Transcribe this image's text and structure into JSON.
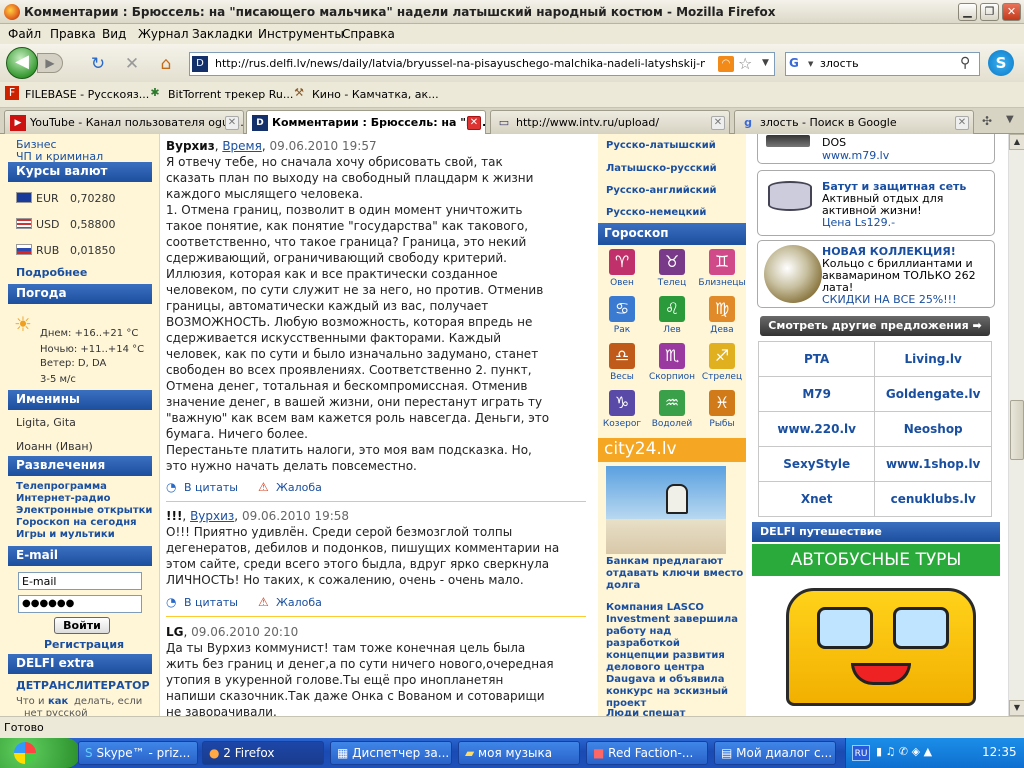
{
  "window": {
    "title": "Комментарии : Брюссель: на \"писающего мальчика\" надели латышский народный костюм - Mozilla Firefox"
  },
  "menu": [
    "Файл",
    "Правка",
    "Вид",
    "Журнал",
    "Закладки",
    "Инструменты",
    "Справка"
  ],
  "nav": {
    "url": "http://rus.delfi.lv/news/daily/latvia/bryussel-na-pisayuschego-malchika-nadeli-latyshskij-narodnyj-kostyum.d?id",
    "search_value": "злость"
  },
  "bookmarks": [
    {
      "label": "FILEBASE - Русскояз...",
      "icon": "filebase-icon",
      "color": "#cc2200"
    },
    {
      "label": "BitTorrent трекер Ru...",
      "icon": "bittorrent-icon",
      "color": "#2d7a2d"
    },
    {
      "label": "Кино - Камчатка, ак...",
      "icon": "broom-icon",
      "color": "#8a5a2a"
    }
  ],
  "tabs": [
    {
      "label": "YouTube - Канал пользователя ogut...",
      "icon": "youtube-icon",
      "active": false
    },
    {
      "label": "Комментарии : Брюссель: на \"п...",
      "icon": "delfi-icon",
      "active": true
    },
    {
      "label": "http://www.intv.ru/upload/",
      "icon": "page-icon",
      "active": false
    },
    {
      "label": "злость - Поиск в Google",
      "icon": "google-icon",
      "active": false
    }
  ],
  "left": {
    "links_top": [
      "Бизнес",
      "ЧП и криминал"
    ],
    "currency_title": "Курсы валют",
    "currencies": [
      {
        "code": "EUR",
        "rate": "0,70280",
        "flag": "eu-flag-icon"
      },
      {
        "code": "USD",
        "rate": "0,58800",
        "flag": "us-flag-icon"
      },
      {
        "code": "RUB",
        "rate": "0,01850",
        "flag": "ru-flag-icon"
      }
    ],
    "more": "Подробнее",
    "weather_title": "Погода",
    "weather": [
      "Днем: +16..+21 °C",
      "Ночью: +11..+14 °C",
      "Ветер: D, DA",
      "3-5 м/с"
    ],
    "names_title": "Именины",
    "names": [
      "Ligita, Gita",
      "Иоанн (Иван)"
    ],
    "fun_title": "Развлечения",
    "fun_links": [
      "Телепрограмма",
      "Интернет-радио",
      "Электронные открытки",
      "Гороскоп на сегодня",
      "Игры и мультики"
    ],
    "email_title": "E-mail",
    "email_placeholder": "E-mail",
    "password_value": "●●●●●●",
    "login_button": "Войти",
    "register": "Регистрация",
    "extra_title": "DELFI extra",
    "translit": "ДЕТРАНСЛИТЕРАТОР",
    "translit_desc": [
      "Что и",
      "как",
      "делать, если",
      "нет русской"
    ]
  },
  "comments": [
    {
      "author": "Вурхиз",
      "author_link": "Время",
      "date": "09.06.2010 19:57",
      "lines": [
        "Я отвечу тебе, но сначала хочу обрисовать свой, так",
        "сказать план по выходу на свободный плацдарм к жизни",
        "каждого мыслящего человека.",
        "1. Отмена границ, позволит в один момент уничтожить",
        "такое понятие, как понятие \"государства\" как такового,",
        "соответственно, что такое граница? Граница, это некий",
        "сдерживающий, ограничивающий свободу критерий.",
        "Иллюзия, которая как и все практически созданное",
        "человеком, по сути служит не за него, но против. Отменив",
        "границы, автоматически каждый из вас, получает",
        "ВОЗМОЖНОСТЬ. Любую возможность, которая впредь не",
        "сдерживается искусственными факторами. Каждый",
        "человек, как по сути и было изначально задумано, станет",
        "свободен во всех проявлениях. Соответственно 2. пункт,",
        "Отмена денег, тотальная и бескомпромиссная. Отменив",
        "значение денег, в вашей жизни, они перестанут играть ту",
        "\"важную\" как всем вам кажется роль навсегда. Деньги, это",
        "бумага. Ничего более.",
        "Перестаньте платить налоги, это моя вам подсказка. Но,",
        "это нужно начать делать повсеместно."
      ]
    },
    {
      "author": "!!!",
      "author_link": "Вурхиз",
      "date": "09.06.2010 19:58",
      "lines": [
        "О!!! Приятно удивлён. Среди серой безмозглой толпы",
        "дегенератов, дебилов и подонков, пишущих комментарии на",
        "этом сайте, среди всего этого быдла, вдруг ярко сверкнула",
        "ЛИЧНОСТЬ! Но таких, к сожалению, очень - очень мало."
      ]
    },
    {
      "author": "LG",
      "author_link": "",
      "date": "09.06.2010 20:10",
      "lines": [
        "Да ты Вурхиз коммунист! там тоже конечная цель была",
        "жить без границ и денег,а по сути ничего нового,очередная",
        "утопия в укуренной голове.Ты ещё про инопланетян",
        "напиши сказочник.Так даже Онка с Вованом и сотоварищи",
        "не заворачивали."
      ]
    }
  ],
  "comment_actions": {
    "quote": "В цитаты",
    "complaint": "Жалоба"
  },
  "mid": {
    "dict_links": [
      "Русско-латышский",
      "Латышско-русский",
      "Русско-английский",
      "Русско-немецкий"
    ],
    "horoscope_title": "Гороскоп",
    "zodiac": [
      {
        "label": "Овен",
        "icon": "aries-icon",
        "color": "#c0306a"
      },
      {
        "label": "Телец",
        "icon": "taurus-icon",
        "color": "#7a3a8a"
      },
      {
        "label": "Близнецы",
        "icon": "gemini-icon",
        "color": "#d04a8a"
      },
      {
        "label": "Рак",
        "icon": "cancer-icon",
        "color": "#3a7ad0"
      },
      {
        "label": "Лев",
        "icon": "leo-icon",
        "color": "#2a9a3a"
      },
      {
        "label": "Дева",
        "icon": "virgo-icon",
        "color": "#e08a2a"
      },
      {
        "label": "Весы",
        "icon": "libra-icon",
        "color": "#c05a1a"
      },
      {
        "label": "Скорпион",
        "icon": "scorpio-icon",
        "color": "#9a3aa0"
      },
      {
        "label": "Стрелец",
        "icon": "sagittarius-icon",
        "color": "#e0b020"
      },
      {
        "label": "Козерог",
        "icon": "capricorn-icon",
        "color": "#5a4aa8"
      },
      {
        "label": "Водолей",
        "icon": "aquarius-icon",
        "color": "#3aa04a"
      },
      {
        "label": "Рыбы",
        "icon": "pisces-icon",
        "color": "#d07a1a"
      }
    ],
    "city24": "city24.lv",
    "news": [
      "Банкам предлагают отдавать ключи вместо долга",
      "Компания LASCO Investment завершила работу над разработкой концепции развития делового центра Daugava и объявила конкурс на эскизный проект",
      "Люди спешат продавать"
    ]
  },
  "right": {
    "ad1": [
      "DOS",
      "www.m79.lv"
    ],
    "ad2": {
      "title": "Батут и защитная сеть",
      "text": [
        "Активный отдых для",
        "активной жизни!"
      ],
      "price": "Цена Ls129.-"
    },
    "ad3": {
      "title": "НОВАЯ КОЛЛЕКЦИЯ!",
      "text": [
        "Кольцо с бриллиантами и",
        "аквамарином ТОЛЬКО 262",
        "лата!"
      ],
      "promo": "СКИДКИ НА ВСЕ 25%!!!"
    },
    "more_offers": "Смотреть другие предложения ➡",
    "shops": [
      [
        "PTA",
        "Living.lv"
      ],
      [
        "M79",
        "Goldengate.lv"
      ],
      [
        "www.220.lv",
        "Neoshop"
      ],
      [
        "SexyStyle",
        "www.1shop.lv"
      ],
      [
        "Xnet",
        "cenuklubs.lv"
      ]
    ],
    "travel_title": "DELFI путешествие",
    "bus_banner": "АВТОБУСНЫЕ ТУРЫ"
  },
  "status": "Готово",
  "taskbar": {
    "items": [
      {
        "label": "Skype™ - priz...",
        "icon": "skype-icon"
      },
      {
        "label": "2 Firefox",
        "icon": "firefox-icon"
      },
      {
        "label": "Диспетчер за...",
        "icon": "taskmgr-icon"
      },
      {
        "label": "моя музыка",
        "icon": "folder-icon"
      },
      {
        "label": "Red Faction-...",
        "icon": "game-icon"
      },
      {
        "label": "Мой диалог с...",
        "icon": "document-icon"
      }
    ],
    "lang": "RU",
    "clock": "12:35"
  }
}
